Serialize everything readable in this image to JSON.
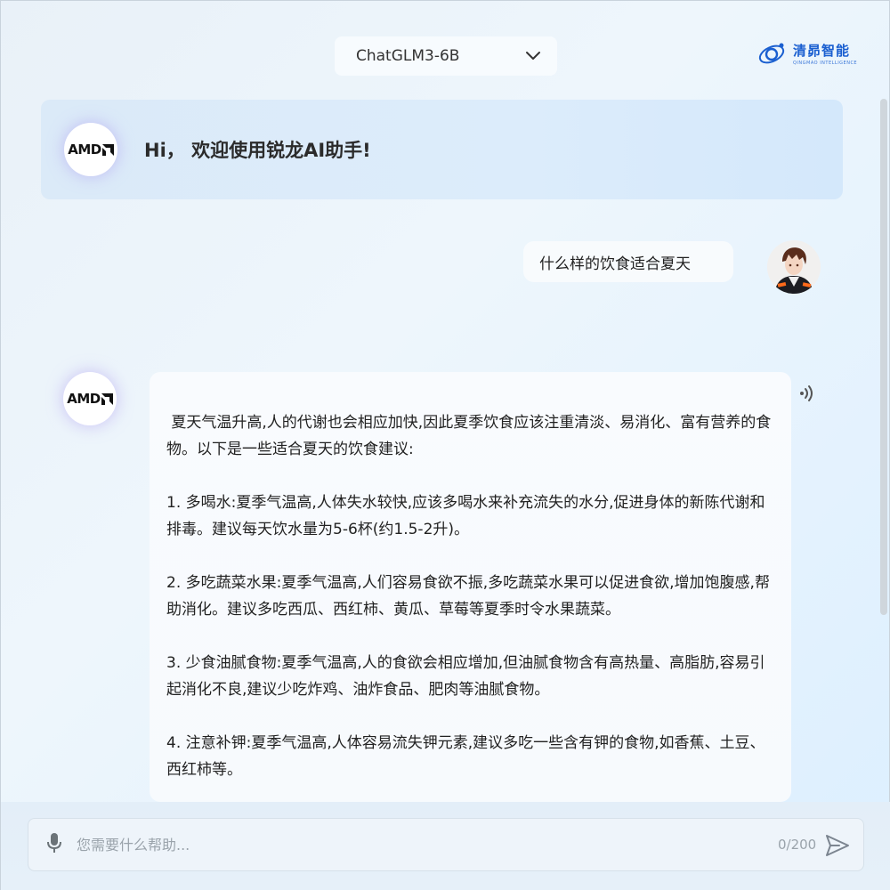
{
  "header": {
    "model_select": {
      "value": "ChatGLM3-6B",
      "icon": "chevron-down-icon"
    },
    "brand": {
      "name_cn": "清昴智能",
      "name_en": "QINGMAO INTELLIGENCE",
      "icon": "brand-logo-icon"
    }
  },
  "welcome": {
    "avatar_text": "AMD",
    "greeting": "Hi， 欢迎使用锐龙AI助手!"
  },
  "conversation": {
    "user_message": "什么样的饮食适合夏天",
    "bot_avatar_text": "AMD",
    "bot_paragraphs": [
      " 夏天气温升高,人的代谢也会相应加快,因此夏季饮食应该注重清淡、易消化、富有营养的食物。以下是一些适合夏天的饮食建议:",
      "1. 多喝水:夏季气温高,人体失水较快,应该多喝水来补充流失的水分,促进身体的新陈代谢和排毒。建议每天饮水量为5-6杯(约1.5-2升)。",
      "2. 多吃蔬菜水果:夏季气温高,人们容易食欲不振,多吃蔬菜水果可以促进食欲,增加饱腹感,帮助消化。建议多吃西瓜、西红柿、黄瓜、草莓等夏季时令水果蔬菜。",
      "3. 少食油腻食物:夏季气温高,人的食欲会相应增加,但油腻食物含有高热量、高脂肪,容易引起消化不良,建议少吃炸鸡、油炸食品、肥肉等油腻食物。",
      "4. 注意补钾:夏季气温高,人体容易流失钾元素,建议多吃一些含有钾的食物,如香蕉、土豆、西红柿等。"
    ],
    "speaker_icon": "speaker-icon"
  },
  "input": {
    "placeholder": "您需要什么帮助...",
    "value": "",
    "counter": "0/200",
    "mic_icon": "microphone-icon",
    "send_icon": "send-icon"
  }
}
